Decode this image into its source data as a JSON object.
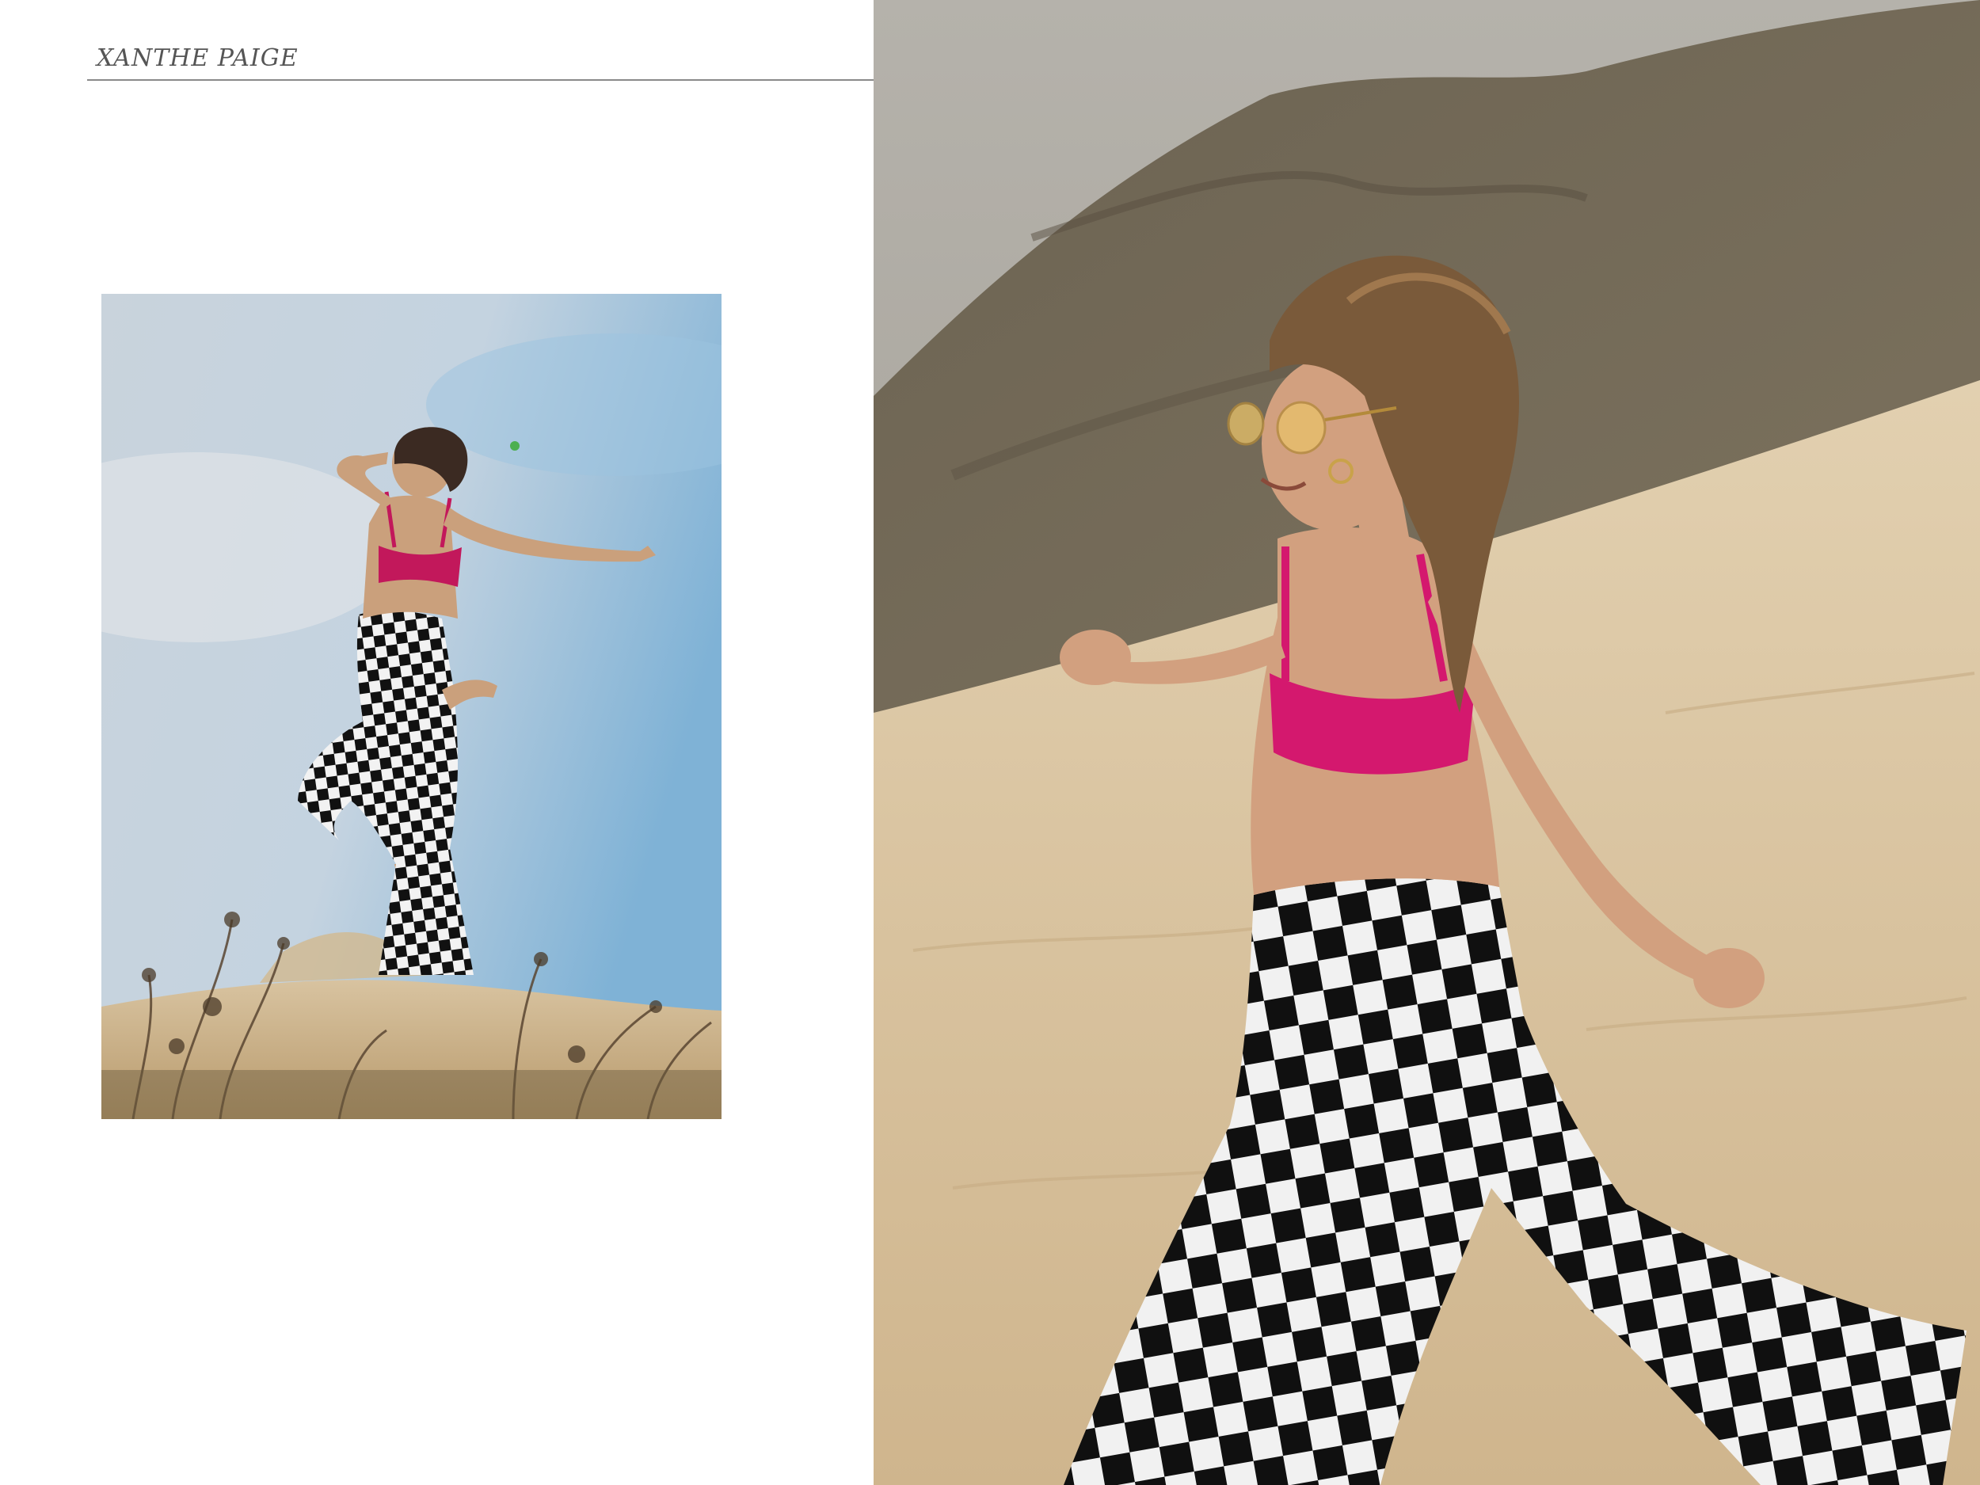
{
  "header": {
    "author": "XANTHE PAIGE"
  },
  "photos": {
    "left": {
      "subject": "woman-jumping-on-dune",
      "colors": {
        "sky_top": "#b6c7d8",
        "sky_right": "#8fbbd9",
        "sand": "#cdb48d",
        "top": "#c2185b",
        "skin": "#caa07c",
        "hair": "#3b2a22"
      }
    },
    "right": {
      "subject": "woman-running-on-sand",
      "colors": {
        "sky": "#a9a49b",
        "hill": "#6f6553",
        "sand": "#d8c4a0",
        "top": "#d4186e",
        "skin": "#d2a07f",
        "hair": "#7a5a3a"
      }
    }
  }
}
